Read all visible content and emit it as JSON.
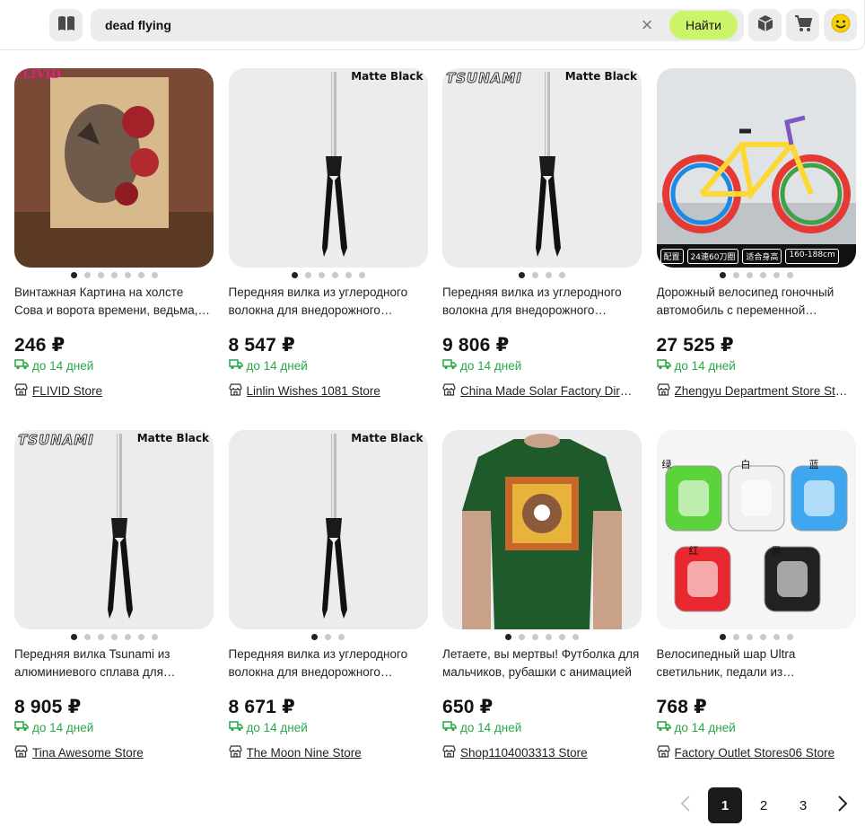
{
  "search": {
    "query": "dead flying",
    "find_label": "Найти"
  },
  "icons": {
    "catalog": "book-icon",
    "clear": "close-icon",
    "orders": "boxes-icon",
    "cart": "cart-icon",
    "profile": "smiley-icon"
  },
  "products": [
    {
      "title": "Винтажная Картина на холсте Сова и ворота времени, ведьма, Волк...",
      "price": "246 ₽",
      "delivery": "до 14 дней",
      "store": "FLIVID Store",
      "dots": 7,
      "active": 0,
      "image": "wolf-painting",
      "brand": "FLIVID"
    },
    {
      "title": "Передняя вилка из углеродного волокна для внедорожного велосипеда",
      "price": "8 547 ₽",
      "delivery": "до 14 дней",
      "store": "Linlin Wishes 1081 Store",
      "dots": 6,
      "active": 0,
      "image": "fork",
      "brand": "Matte Black"
    },
    {
      "title": "Передняя вилка из углеродного волокна для внедорожного велосипеда",
      "price": "9 806 ₽",
      "delivery": "до 14 дней",
      "store": "China Made Solar Factory Direct Store",
      "dots": 4,
      "active": 0,
      "image": "fork",
      "brand": "Matte Black",
      "logo": "TSUNAMI"
    },
    {
      "title": "Дорожный велосипед гоночный автомобиль с переменной скоростью",
      "price": "27 525 ₽",
      "delivery": "до 14 дней",
      "store": "Zhengyu Department Store Store",
      "dots": 6,
      "active": 0,
      "image": "bicycle",
      "specs": [
        "配置",
        "24速60刀圈",
        "适合身高",
        "160-188cm"
      ]
    },
    {
      "title": "Передняя вилка Tsunami из алюминиевого сплава для велосипеда",
      "price": "8 905 ₽",
      "delivery": "до 14 дней",
      "store": "Tina Awesome Store",
      "dots": 7,
      "active": 0,
      "image": "fork",
      "brand": "Matte Black",
      "logo": "TSUNAMI"
    },
    {
      "title": "Передняя вилка из углеродного волокна для внедорожного велосипеда",
      "price": "8 671 ₽",
      "delivery": "до 14 дней",
      "store": "The Moon Nine Store",
      "dots": 3,
      "active": 0,
      "image": "fork",
      "brand": "Matte Black"
    },
    {
      "title": "Летаете, вы мертвы! Футболка для мальчиков, рубашки с анимацией",
      "price": "650 ₽",
      "delivery": "до 14 дней",
      "store": "Shop1104003313 Store",
      "dots": 6,
      "active": 0,
      "image": "tshirt"
    },
    {
      "title": "Велосипедный шар Ultra светильник, педали из алюминиевого сплава",
      "price": "768 ₽",
      "delivery": "до 14 дней",
      "store": "Factory Outlet Stores06 Store",
      "dots": 6,
      "active": 0,
      "image": "pedals",
      "pedal_labels": [
        "绿",
        "白",
        "蓝",
        "红",
        "黑"
      ]
    }
  ],
  "pagination": {
    "pages": [
      "1",
      "2",
      "3"
    ],
    "current": "1"
  },
  "colors": {
    "accent": "#ccf46a",
    "delivery": "#28a745",
    "field_bg": "#ececec"
  }
}
